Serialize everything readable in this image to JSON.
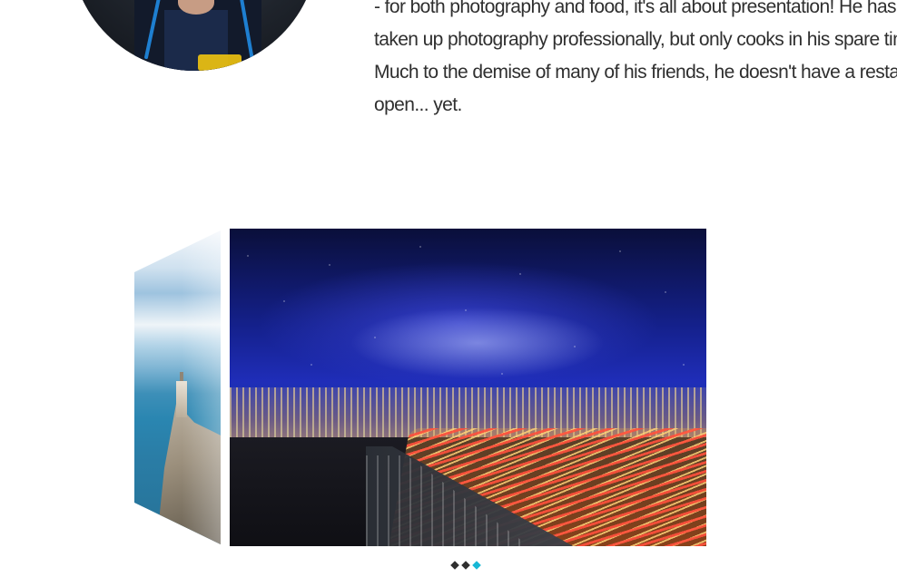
{
  "bio": {
    "lines": [
      "- for both photography and food, it's all about presentation! He has",
      "taken up photography professionally, but only cooks in his spare time.",
      "Much to the demise of many of his friends, he doesn't have a restaurant",
      "open... yet."
    ]
  },
  "carousel": {
    "active_index": 2,
    "dots": [
      "slide-1",
      "slide-2",
      "slide-3"
    ],
    "accent_color": "#17b7d5",
    "dot_color": "#2f2f2f"
  }
}
